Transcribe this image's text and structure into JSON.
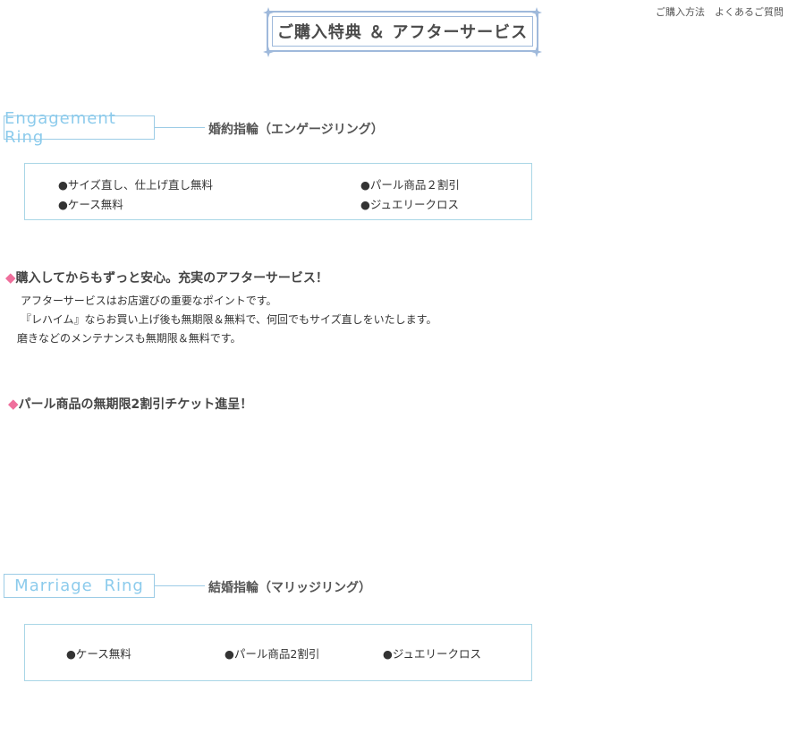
{
  "top_links": [
    "ご購入方法",
    "よくあるご質問"
  ],
  "title": "ご購入特典 ＆ アフターサービス",
  "engagement": {
    "label": "Engagement  Ring",
    "jp": "婚約指輪（エンゲージリング）",
    "benefits": [
      "●サイズ直し、仕上げ直し無料",
      "●パール商品２割引",
      "●ケース無料",
      "●ジュエリークロス"
    ]
  },
  "after_service": {
    "heading": "購入してからもずっと安心。充実のアフターサービス！",
    "lines": [
      "アフターサービスはお店選びの重要なポイントです。",
      "『レハイム』ならお買い上げ後も無期限＆無料で、何回でもサイズ直しをいたします。",
      "磨きなどのメンテナンスも無期限＆無料です。"
    ]
  },
  "pearl": {
    "heading": "パール商品の無期限2割引チケット進呈！"
  },
  "marriage": {
    "label": "Marriage  Ring",
    "jp": "結婚指輪（マリッジリング）",
    "benefits": [
      "●ケース無料",
      "●パール商品2割引",
      "●ジュエリークロス"
    ]
  },
  "diamond_symbol": "◆",
  "colors": {
    "accent_blue": "#8ccbec",
    "frame_blue": "#9fb9db",
    "pink": "#ef6f9c"
  }
}
